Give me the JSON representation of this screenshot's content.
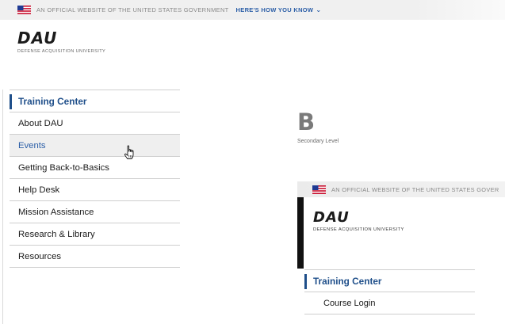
{
  "gov_banner": {
    "text": "AN OFFICIAL WEBSITE OF THE UNITED STATES GOVERNMENT",
    "link": "HERE'S HOW YOU KNOW",
    "chevron": "⌄"
  },
  "logo": {
    "name": "DAU",
    "subtitle": "DEFENSE ACQUISITION UNIVERSITY"
  },
  "nav": {
    "items": [
      {
        "label": "Training Center",
        "state": "active"
      },
      {
        "label": "About DAU",
        "state": "normal"
      },
      {
        "label": "Events",
        "state": "hover"
      },
      {
        "label": "Getting Back-to-Basics",
        "state": "normal"
      },
      {
        "label": "Help Desk",
        "state": "normal"
      },
      {
        "label": "Mission Assistance",
        "state": "normal"
      },
      {
        "label": "Research & Library",
        "state": "normal"
      },
      {
        "label": "Resources",
        "state": "normal"
      }
    ]
  },
  "level_preview": {
    "letter": "B",
    "caption": "Secondary Level"
  },
  "preview": {
    "banner_text": "AN OFFICIAL WEBSITE OF THE UNITED STATES GOVER",
    "logo": "DAU",
    "logo_subtitle": "DEFENSE ACQUISITION UNIVERSITY",
    "items": [
      {
        "label": "Training Center"
      },
      {
        "label": "Course Login"
      }
    ]
  },
  "colors": {
    "accent": "#1f4f8a",
    "link": "#2b5ea7",
    "banner_bg": "#f0f0f0"
  },
  "icons": [
    "us-flag-icon",
    "chevron-down-icon",
    "hand-pointer-cursor-icon"
  ]
}
